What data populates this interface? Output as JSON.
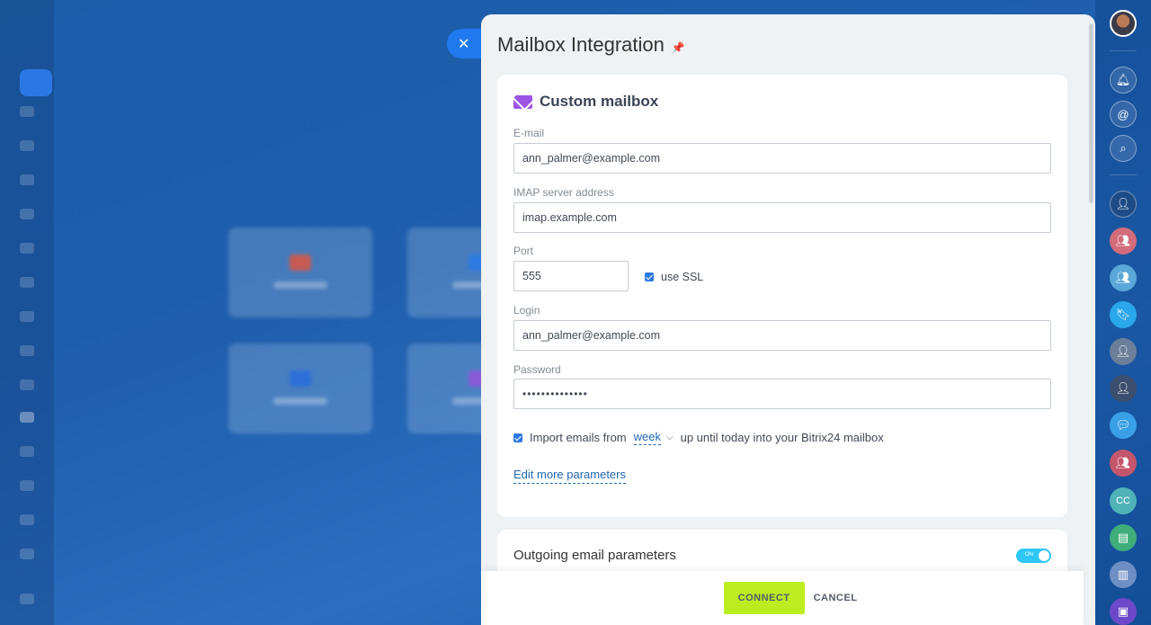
{
  "panel": {
    "title": "Mailbox Integration",
    "close_icon": "close-icon",
    "pin_icon": "pin-icon"
  },
  "custom_mailbox": {
    "heading": "Custom mailbox",
    "icon": "envelope-icon",
    "email_label": "E-mail",
    "email_value": "ann_palmer@example.com",
    "imap_label": "IMAP server address",
    "imap_value": "imap.example.com",
    "port_label": "Port",
    "port_value": "555",
    "ssl_label": "use SSL",
    "ssl_checked": true,
    "login_label": "Login",
    "login_value": "ann_palmer@example.com",
    "password_label": "Password",
    "password_value": "••••••••••••••",
    "import_prefix": "Import emails from",
    "import_period": "week",
    "import_suffix": "up until today into your Bitrix24 mailbox",
    "import_checked": true,
    "edit_more": "Edit more parameters"
  },
  "outgoing": {
    "title": "Outgoing email parameters",
    "toggle_text": "ON",
    "toggle_on": true
  },
  "footer": {
    "connect": "CONNECT",
    "cancel": "CANCEL"
  },
  "rightbar": {
    "items": [
      "avatar",
      "bell-icon",
      "at-icon",
      "chat-search-icon",
      "avatar",
      "group-icon",
      "group-icon",
      "bookmark-icon",
      "avatar",
      "avatar",
      "chat-icon",
      "group-icon",
      "CC",
      "notes-icon",
      "chart-icon",
      "badge-icon"
    ]
  },
  "colors": {
    "accent": "#2079ee",
    "connect": "#bbed21",
    "toggle": "#2fc6f6",
    "mail_icon": "#9b54e6"
  }
}
